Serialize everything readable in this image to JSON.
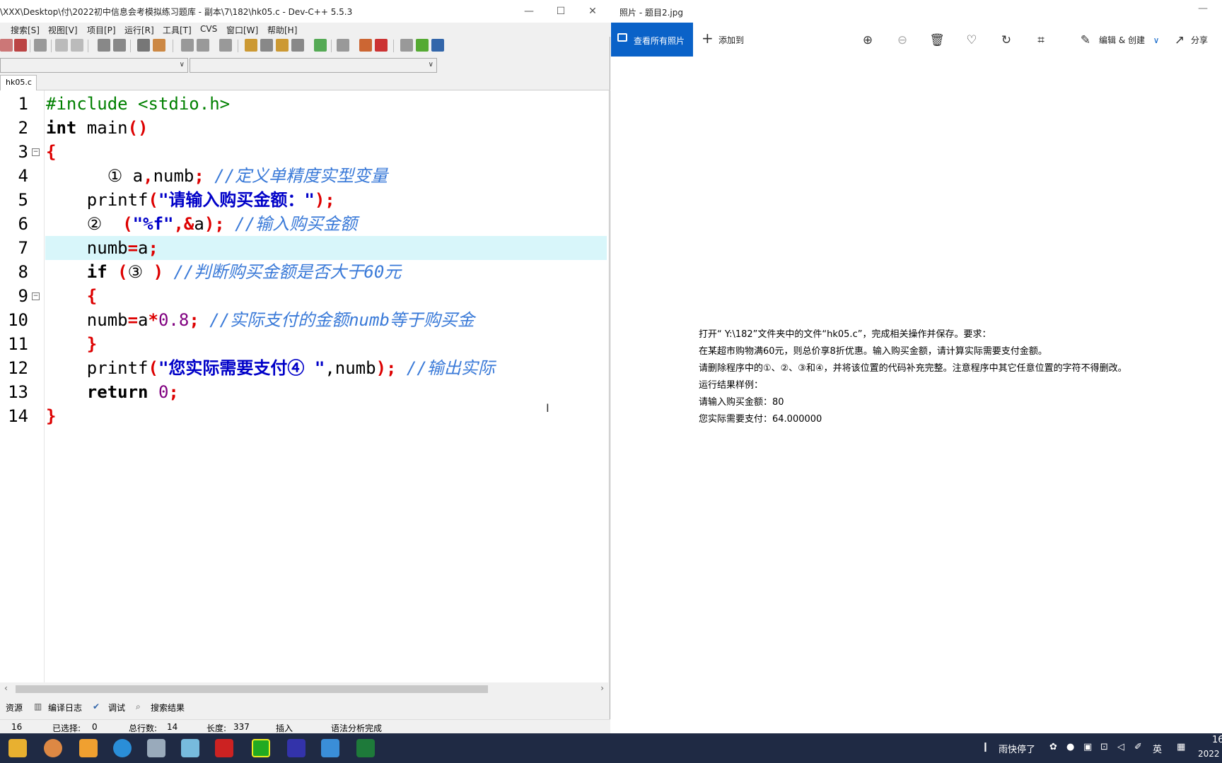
{
  "devcpp": {
    "title": "\\XXX\\Desktop\\付\\2022初中信息会考模拟练习题库 - 副本\\7\\182\\hk05.c - Dev-C++ 5.5.3",
    "menu": [
      "搜索[S]",
      "视图[V]",
      "项目[P]",
      "运行[R]",
      "工具[T]",
      "CVS",
      "窗口[W]",
      "帮助[H]"
    ],
    "tab": "hk05.c",
    "line_numbers": [
      "1",
      "2",
      "3",
      "4",
      "5",
      "6",
      "7",
      "8",
      "9",
      "10",
      "11",
      "12",
      "13",
      "14"
    ],
    "code": {
      "l1": "#include <stdio.h>",
      "l2_kw": "int",
      "l2_rest": " main",
      "l2_p": "()",
      "l3": "{",
      "l4_a": "      ① a",
      "l4_c": ",",
      "l4_b": "numb",
      "l4_s": ";",
      "l4_cm": " //定义单精度实型变量",
      "l5_a": "    printf",
      "l5_p": "(",
      "l5_s": "\"请输入购买金额：\"",
      "l5_e": ");",
      "l6_a": "    ②  ",
      "l6_p": "(",
      "l6_s": "\"%f\"",
      "l6_m": ",&",
      "l6_v": "a",
      "l6_e": ");",
      "l6_cm": " //输入购买金额",
      "l7_a": "    numb",
      "l7_eq": "=",
      "l7_v": "a",
      "l7_e": ";",
      "l8_kw": "    if",
      "l8_p": " (",
      "l8_m": "③ ",
      "l8_e": ")",
      "l8_cm": " //判断购买金额是否大于60元",
      "l9": "    {",
      "l10_a": "    numb",
      "l10_eq": "=",
      "l10_v": "a",
      "l10_op": "*",
      "l10_n": "0.8",
      "l10_e": ";",
      "l10_cm": " //实际支付的金额numb等于购买金",
      "l11": "    }",
      "l12_a": "    printf",
      "l12_p": "(",
      "l12_s": "\"您实际需要支付④ \"",
      "l12_m": ",numb",
      "l12_e": ");",
      "l12_cm": " //输出实际",
      "l13_kw": "    return",
      "l13_n": " 0",
      "l13_e": ";",
      "l14": "}"
    },
    "bottom_tabs": [
      "资源",
      "编译日志",
      "调试",
      "搜索结果"
    ],
    "status": {
      "line": "16",
      "sel_label": "已选择:",
      "sel": "0",
      "total_label": "总行数:",
      "total": "14",
      "len_label": "长度:",
      "len": "337",
      "mode": "插入",
      "parse": "语法分析完成"
    }
  },
  "photos": {
    "title": "照片 - 题目2.jpg",
    "view_all": "查看所有照片",
    "add_to": "添加到",
    "edit_create": "编辑 & 创建",
    "share": "分享",
    "doc_lines": [
      "打开“ Y:\\182”文件夹中的文件“hk05.c”，完成相关操作并保存。要求：",
      "在某超市购物满60元，则总价享8折优惠。输入购买金额，请计算实际需要支付金额。",
      "请删除程序中的①、②、③和④，并将该位置的代码补充完整。注意程序中其它任意位置的字符不得删改。",
      "运行结果样例：",
      "请输入购买金额：80",
      "您实际需要支付：64.000000"
    ]
  },
  "taskbar": {
    "weather": "雨快停了",
    "ime": "英",
    "time": "16",
    "date": "2022"
  }
}
